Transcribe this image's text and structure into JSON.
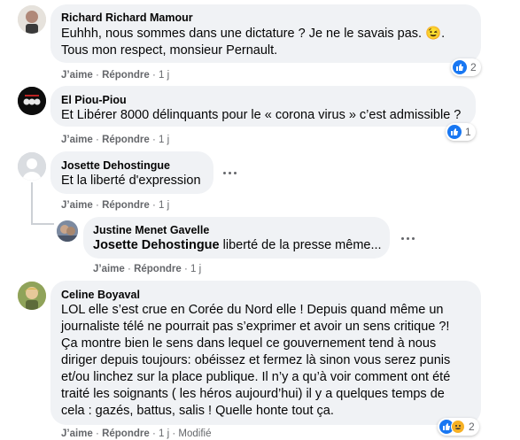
{
  "comments": [
    {
      "author": "Richard Richard Mamour",
      "line1": "Euhhh, nous sommes dans une dictature ? Je ne le savais pas. 😉.",
      "line2": "Tous mon respect, monsieur Pernault.",
      "like": "J’aime",
      "reply": "Répondre",
      "time": "1 j",
      "reaction_count": "2"
    },
    {
      "author": "El Piou-Piou",
      "line1": "Et Libérer 8000 délinquants pour le « corona virus » c’est admissible ?",
      "like": "J’aime",
      "reply": "Répondre",
      "time": "1 j",
      "reaction_count": "1"
    },
    {
      "author": "Josette Dehostingue",
      "line1": "Et la liberté d'expression",
      "like": "J’aime",
      "reply": "Répondre",
      "time": "1 j"
    },
    {
      "author": "Justine Menet Gavelle",
      "mention": "Josette Dehostingue",
      "line1": " liberté de la presse même...",
      "like": "J’aime",
      "reply": "Répondre",
      "time": "1 j"
    },
    {
      "author": "Celine Boyaval",
      "lines": [
        "LOL elle s’est crue en Corée du Nord elle ! Depuis quand même un",
        "journaliste télé ne pourrait pas s’exprimer et avoir un sens critique ?!",
        "Ça montre bien le sens dans lequel ce gouvernement tend à nous",
        "diriger depuis toujours: obéissez et fermez là sinon vous serez punis",
        "et/ou linchez sur la place publique. Il n’y a qu’à voir comment ont été",
        "traité les soignants ( les héros aujourd’hui) il y a quelques temps de",
        "cela : gazés, battus, salis ! Quelle honte tout ça."
      ],
      "like": "J’aime",
      "reply": "Répondre",
      "time": "1 j",
      "edited": "Modifié",
      "reaction_count": "2"
    }
  ],
  "separator": "·",
  "colors": {
    "bubble": "#f0f2f5",
    "like_blue": "#1877f2",
    "meta_gray": "#65676b",
    "haha_yellow": "#f7b125"
  },
  "icons": [
    "more-options-icon",
    "like-reaction-icon",
    "haha-reaction-icon"
  ]
}
